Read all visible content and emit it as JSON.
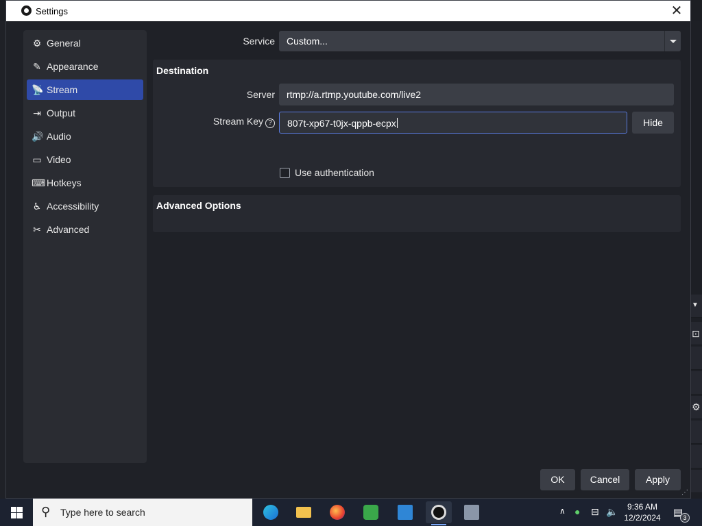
{
  "window": {
    "title": "Settings",
    "close_glyph": "✕"
  },
  "sidebar": {
    "items": [
      {
        "label": "General",
        "icon": "gear-icon",
        "glyph": "⚙"
      },
      {
        "label": "Appearance",
        "icon": "appearance-icon",
        "glyph": "✎"
      },
      {
        "label": "Stream",
        "icon": "antenna-icon",
        "glyph": "📡"
      },
      {
        "label": "Output",
        "icon": "output-icon",
        "glyph": "⇥"
      },
      {
        "label": "Audio",
        "icon": "speaker-icon",
        "glyph": "🔊"
      },
      {
        "label": "Video",
        "icon": "monitor-icon",
        "glyph": "▭"
      },
      {
        "label": "Hotkeys",
        "icon": "keyboard-icon",
        "glyph": "⌨"
      },
      {
        "label": "Accessibility",
        "icon": "accessibility-icon",
        "glyph": "♿"
      },
      {
        "label": "Advanced",
        "icon": "wrench-icon",
        "glyph": "✂"
      }
    ],
    "active": "Stream"
  },
  "stream": {
    "service_label": "Service",
    "service_value": "Custom...",
    "destination_title": "Destination",
    "server_label": "Server",
    "server_value": "rtmp://a.rtmp.youtube.com/live2",
    "stream_key_label": "Stream Key",
    "stream_key_value": "807t-xp67-t0jx-qppb-ecpx",
    "hide_button": "Hide",
    "use_auth_label": "Use authentication",
    "use_auth_checked": false,
    "advanced_title": "Advanced Options"
  },
  "footer": {
    "ok": "OK",
    "cancel": "Cancel",
    "apply": "Apply"
  },
  "taskbar": {
    "search_placeholder": "Type here to search",
    "apps": [
      "edge-icon",
      "file-explorer-icon",
      "firefox-icon",
      "app-green-icon",
      "app-blue-icon",
      "obs-icon",
      "app-image-icon"
    ],
    "clock_time": "9:36 AM",
    "clock_date": "12/2/2024",
    "notification_count": "3"
  },
  "colors": {
    "accent": "#2f4aa8",
    "window_bg": "#1f2127",
    "panel_bg": "#2a2c32",
    "taskbar_bg": "#1c2230"
  }
}
